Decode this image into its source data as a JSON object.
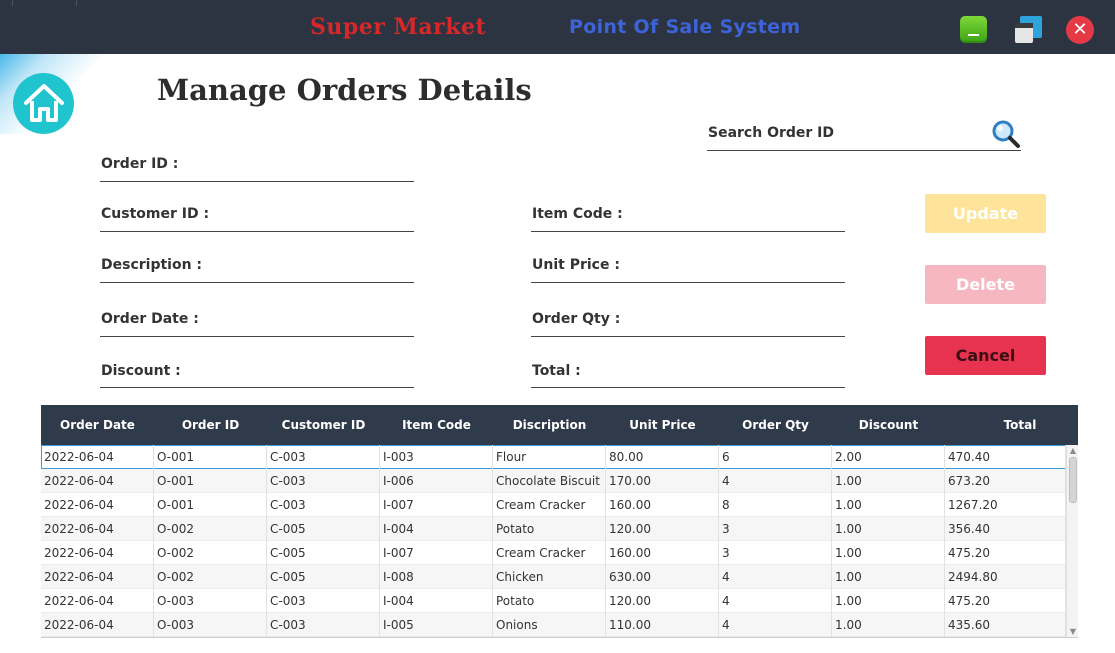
{
  "window": {
    "title": "Super Market",
    "subtitle": "Point Of Sale System",
    "close_glyph": "✕"
  },
  "page": {
    "title": "Manage Orders Details"
  },
  "search": {
    "label": "Search Order ID",
    "icon": "search-icon"
  },
  "form": {
    "order_id": "Order ID :",
    "customer_id": "Customer ID :",
    "description": "Description :",
    "order_date": "Order Date :",
    "discount": "Discount :",
    "item_code": "Item Code :",
    "unit_price": "Unit Price :",
    "order_qty": "Order Qty :",
    "total": "Total :"
  },
  "buttons": {
    "update": "Update",
    "delete": "Delete",
    "cancel": "Cancel"
  },
  "colors": {
    "titlebar": "#2c3442",
    "brand_red": "#d62828",
    "brand_blue": "#3d63d8",
    "table_header": "#2f3b4a",
    "update": "#fde49a",
    "delete": "#f6b7c0",
    "cancel": "#e83350"
  },
  "table": {
    "columns": [
      "Order Date",
      "Order ID",
      "Customer ID",
      "Item Code",
      "Discription",
      "Unit Price",
      "Order Qty",
      "Discount",
      "Total"
    ],
    "rows": [
      [
        "2022-06-04",
        "O-001",
        "C-003",
        "I-003",
        "Flour",
        "80.00",
        "6",
        "2.00",
        "470.40"
      ],
      [
        "2022-06-04",
        "O-001",
        "C-003",
        "I-006",
        "Chocolate Biscuit",
        "170.00",
        "4",
        "1.00",
        "673.20"
      ],
      [
        "2022-06-04",
        "O-001",
        "C-003",
        "I-007",
        "Cream Cracker",
        "160.00",
        "8",
        "1.00",
        "1267.20"
      ],
      [
        "2022-06-04",
        "O-002",
        "C-005",
        "I-004",
        "Potato",
        "120.00",
        "3",
        "1.00",
        "356.40"
      ],
      [
        "2022-06-04",
        "O-002",
        "C-005",
        "I-007",
        "Cream Cracker",
        "160.00",
        "3",
        "1.00",
        "475.20"
      ],
      [
        "2022-06-04",
        "O-002",
        "C-005",
        "I-008",
        "Chicken",
        "630.00",
        "4",
        "1.00",
        "2494.80"
      ],
      [
        "2022-06-04",
        "O-003",
        "C-003",
        "I-004",
        "Potato",
        "120.00",
        "4",
        "1.00",
        "475.20"
      ],
      [
        "2022-06-04",
        "O-003",
        "C-003",
        "I-005",
        "Onions",
        "110.00",
        "4",
        "1.00",
        "435.60"
      ]
    ]
  }
}
